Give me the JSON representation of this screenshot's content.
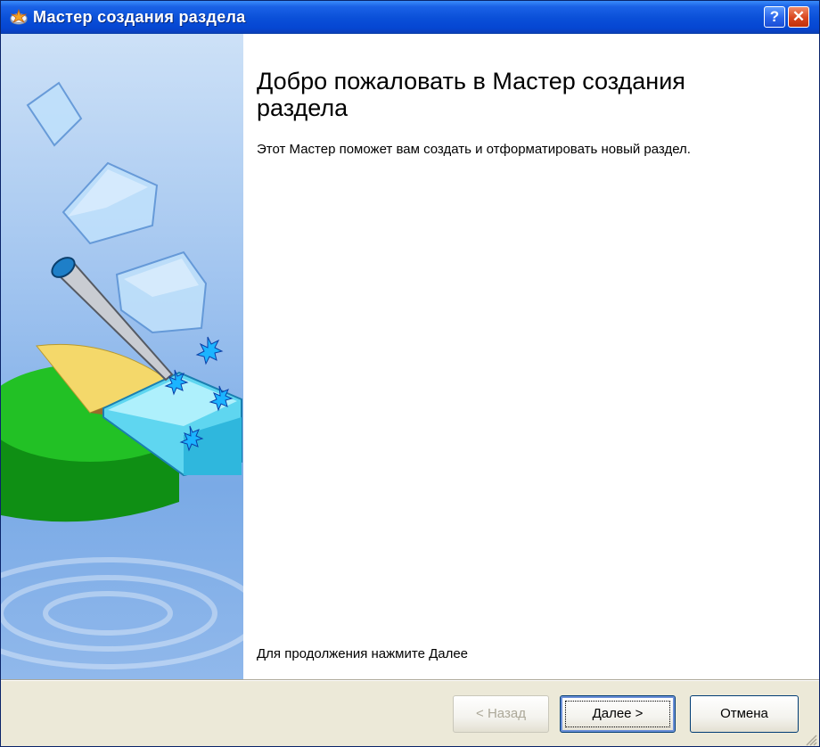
{
  "window": {
    "title": "Мастер создания раздела",
    "icon": "wizard-disk-icon",
    "help_glyph": "?",
    "close_glyph": "✕"
  },
  "content": {
    "heading": "Добро пожаловать в Мастер создания раздела",
    "description": "Этот Мастер поможет вам создать и отформатировать новый раздел.",
    "footer_note": "Для продолжения нажмите Далее"
  },
  "buttons": {
    "back_label": "< Назад",
    "next_label": "Далее >",
    "cancel_label": "Отмена"
  },
  "colors": {
    "titlebar": "#0a4fd8",
    "dialog_face": "#ece9d8",
    "panel_blue": "#7aaae6",
    "pie_green": "#19b81c",
    "pie_yellow": "#f4d86a",
    "cyan_slice": "#5fd6f0"
  }
}
